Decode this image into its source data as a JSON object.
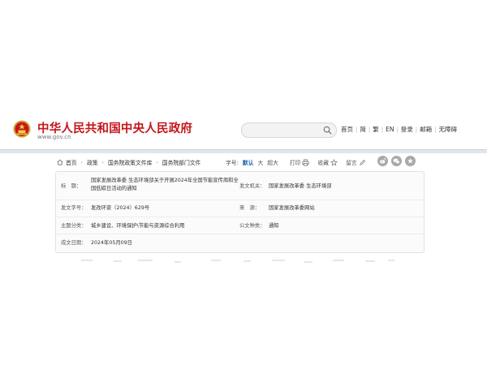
{
  "header": {
    "title": "中华人民共和国中央人民政府",
    "domain": "www.gov.cn",
    "search": {
      "placeholder": "",
      "value": ""
    },
    "nav": [
      "首页",
      "简",
      "繁",
      "EN",
      "登录",
      "邮箱",
      "无障碍"
    ]
  },
  "breadcrumb": [
    "首页",
    "政策",
    "国务院政策文件库",
    "国务院部门文件"
  ],
  "toolbar": {
    "font_label": "字号:",
    "font_default": "默认",
    "font_large": "大",
    "font_xlarge": "超大",
    "print": "打印",
    "favorite": "收藏",
    "comment": "留言"
  },
  "doc": {
    "title_label": "标　题：",
    "title_value_line1": "国家发展改革委 生态环境部关于开展2024年全国节能宣传周和全",
    "title_value_line2": "国低碳日活动的通知",
    "issuer_label": "发文机关：",
    "issuer_value": "国家发展改革委  生态环境部",
    "doc_no_label": "发文字号：",
    "doc_no_value": "发改环资〔2024〕629号",
    "source_label": "来　源：",
    "source_value": "国家发展改革委网站",
    "topic_label": "主题分类：",
    "topic_value": "城乡建设、环境保护\\节能与资源综合利用",
    "type_label": "公文种类：",
    "type_value": "通知",
    "date_label": "成文日期：",
    "date_value": "2024年05月09日"
  },
  "colors": {
    "brand_red": "#c4161c",
    "link_blue": "#1a62b4"
  }
}
